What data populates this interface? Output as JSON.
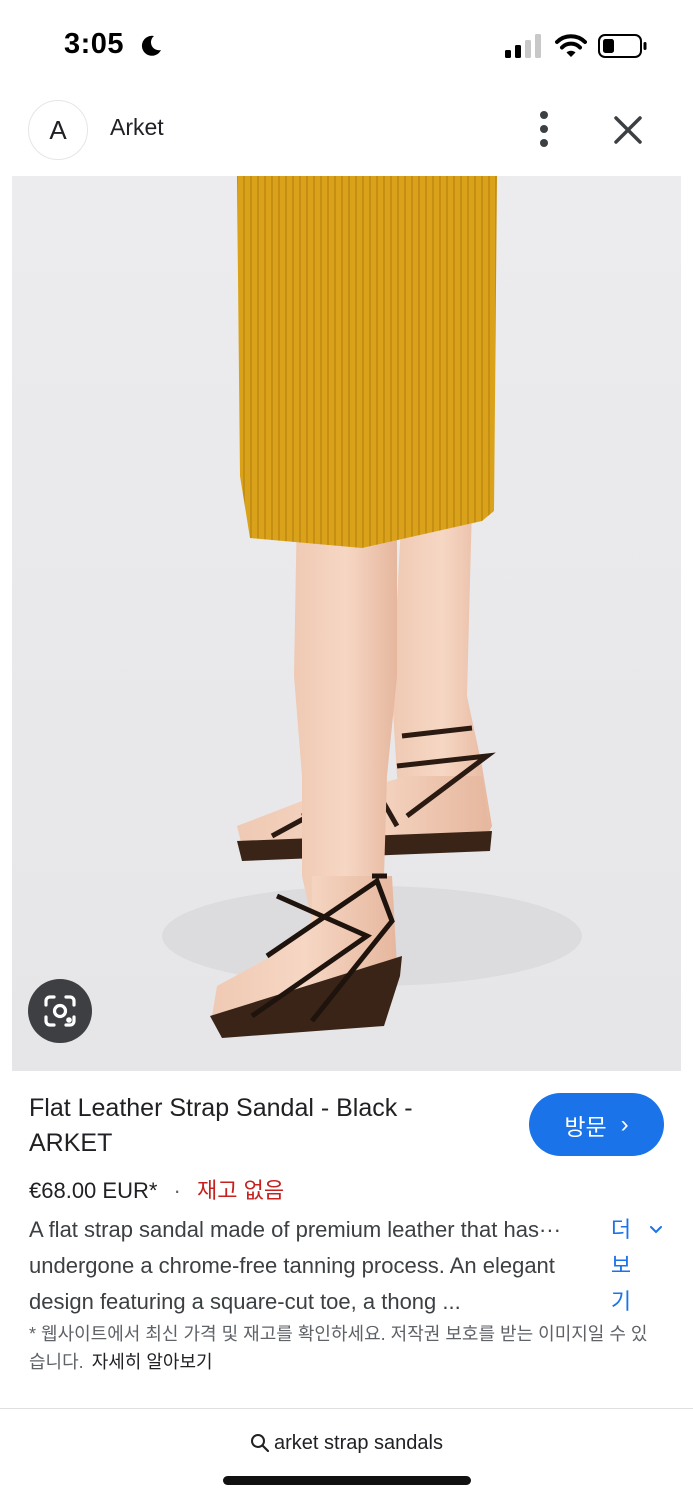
{
  "status_bar": {
    "time": "3:05",
    "icons": [
      "moon-icon",
      "signal-icon",
      "wifi-icon",
      "battery-icon"
    ]
  },
  "header": {
    "avatar_letter": "A",
    "site_name": "Arket",
    "icons": [
      "more-vert-icon",
      "close-icon"
    ]
  },
  "image": {
    "description_icon": "lens-icon"
  },
  "product": {
    "title": "Flat Leather Strap Sandal - Black - ARKET",
    "visit_label": "방문",
    "visit_chevron": "›",
    "price": "€68.00 EUR*",
    "separator": "·",
    "stock": "재고 없음",
    "description": "A flat strap sandal made of premium leather that has··· undergone a chrome-free tanning process. An elegant design featuring a square-cut toe, a thong ...",
    "more_label": "더 보기",
    "disclaimer": "* 웹사이트에서 최신 가격 및 재고를 확인하세요. 저작권 보호를 받는 이미지일 수 있습니다.",
    "learn_more": "자세히 알아보기"
  },
  "search": {
    "query": "arket strap sandals"
  },
  "colors": {
    "accent": "#1a73e8",
    "out_of_stock": "#c5221f",
    "image_background": "#ebebed",
    "skirt": "#d9a21a"
  }
}
